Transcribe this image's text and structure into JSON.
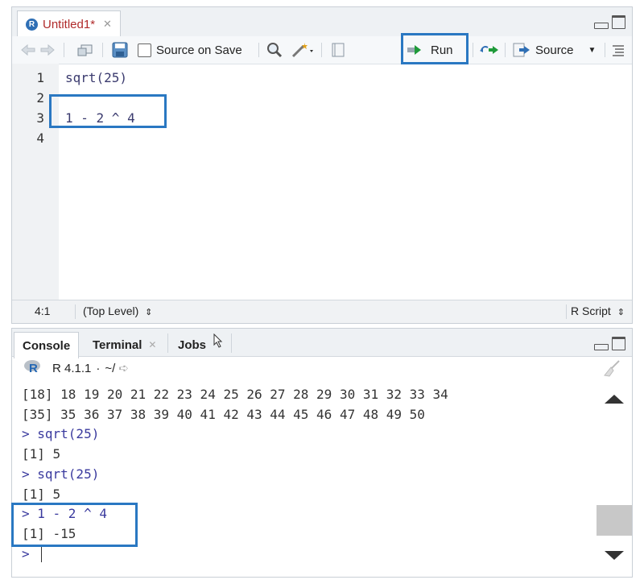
{
  "editor": {
    "tab_title": "Untitled1*",
    "source_on_save_label": "Source on Save",
    "run_label": "Run",
    "source_label": "Source",
    "lines": [
      {
        "num": "1",
        "code": "sqrt(25)"
      },
      {
        "num": "2",
        "code": ""
      },
      {
        "num": "3",
        "code": "1 - 2 ^ 4"
      },
      {
        "num": "4",
        "code": ""
      }
    ],
    "status": {
      "position": "4:1",
      "scope": "(Top Level)",
      "file_type": "R Script"
    }
  },
  "console": {
    "tabs": [
      "Console",
      "Terminal",
      "Jobs"
    ],
    "version": "R 4.1.1",
    "path": "~/",
    "lines": [
      {
        "text": "[18] 18 19 20 21 22 23 24 25 26 27 28 29 30 31 32 33 34",
        "kind": "out"
      },
      {
        "text": "[35] 35 36 37 38 39 40 41 42 43 44 45 46 47 48 49 50",
        "kind": "out"
      },
      {
        "text": "> sqrt(25)",
        "kind": "cmd"
      },
      {
        "text": "[1] 5",
        "kind": "out"
      },
      {
        "text": "> sqrt(25)",
        "kind": "cmd"
      },
      {
        "text": "[1] 5",
        "kind": "out"
      },
      {
        "text": "> 1 - 2 ^ 4",
        "kind": "cmd"
      },
      {
        "text": "[1] -15",
        "kind": "out"
      },
      {
        "text": ">",
        "kind": "cmd"
      }
    ]
  },
  "colors": {
    "highlight": "#2a78c2",
    "command": "#3a3a9e"
  }
}
